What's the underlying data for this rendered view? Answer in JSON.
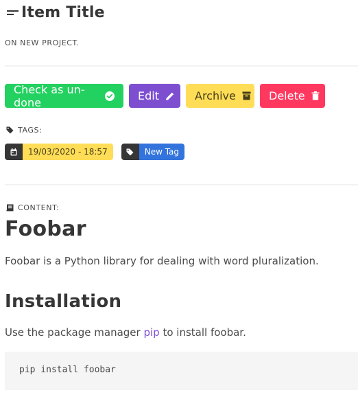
{
  "item": {
    "title": "Item Title",
    "subtitle": "ON NEW PROJECT."
  },
  "actions": {
    "done_label": "Check as un-done",
    "edit_label": "Edit",
    "archive_label": "Archive",
    "delete_label": "Delete"
  },
  "tags": {
    "label": "TAGS:",
    "date": "19/03/2020 - 18:57",
    "items": [
      {
        "label": "New Tag",
        "color": "#3273dc"
      }
    ]
  },
  "content": {
    "label": "CONTENT:",
    "heading": "Foobar",
    "description": "Foobar is a Python library for dealing with word pluralization.",
    "installation_heading": "Installation",
    "install_text_before": "Use the package manager ",
    "install_link": "pip",
    "install_text_after": " to install foobar.",
    "code": "pip install foobar"
  },
  "colors": {
    "success": "#23d160",
    "edit": "#7d4fd0",
    "archive": "#ffdd57",
    "delete": "#ff3860",
    "tag_dark": "#363636",
    "tag_blue": "#3273dc"
  },
  "icons": {
    "title": "bars-icon",
    "done": "check-circle-icon",
    "edit": "pencil-icon",
    "archive": "archive-icon",
    "delete": "trash-icon",
    "tags": "tag-icon",
    "date": "calendar-icon",
    "content": "book-icon"
  }
}
